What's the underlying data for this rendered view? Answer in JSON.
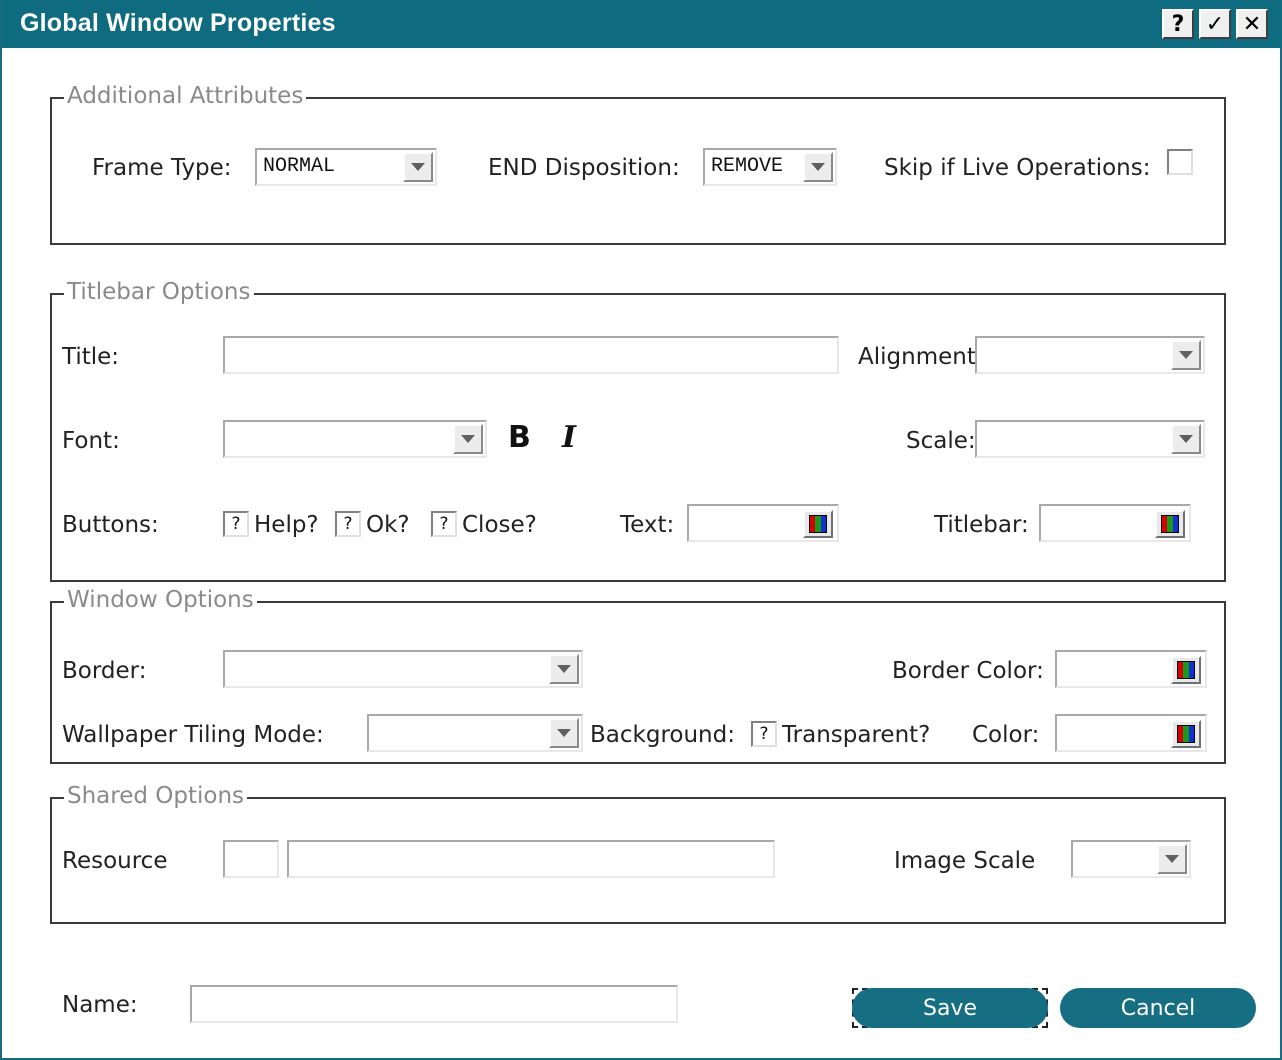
{
  "window": {
    "title": "Global Window Properties",
    "buttons": {
      "help": "?",
      "ok": "✓",
      "close": "✕"
    }
  },
  "additional_attributes": {
    "legend": "Additional Attributes",
    "frame_type_label": "Frame Type:",
    "frame_type_value": "NORMAL",
    "end_disposition_label": "END Disposition:",
    "end_disposition_value": "REMOVE",
    "skip_live_label": "Skip if Live Operations:"
  },
  "titlebar_options": {
    "legend": "Titlebar Options",
    "title_label": "Title:",
    "title_value": "",
    "alignment_label": "Alignment:",
    "alignment_value": "",
    "font_label": "Font:",
    "font_value": "",
    "bold_glyph": "B",
    "italic_glyph": "I",
    "scale_label": "Scale:",
    "scale_value": "",
    "buttons_label": "Buttons:",
    "help_check": "?",
    "help_label": "Help?",
    "ok_check": "?",
    "ok_label": "Ok?",
    "close_check": "?",
    "close_label": "Close?",
    "text_label": "Text:",
    "titlebar_label": "Titlebar:"
  },
  "window_options": {
    "legend": "Window Options",
    "border_label": "Border:",
    "border_value": "",
    "border_color_label": "Border Color:",
    "wallpaper_label": "Wallpaper Tiling Mode:",
    "wallpaper_value": "",
    "background_label": "Background:",
    "transparent_check": "?",
    "transparent_label": "Transparent?",
    "color_label": "Color:"
  },
  "shared_options": {
    "legend": "Shared Options",
    "resource_label": "Resource",
    "resource_short": "",
    "resource_value": "",
    "image_scale_label": "Image Scale",
    "image_scale_value": ""
  },
  "footer": {
    "name_label": "Name:",
    "name_value": "",
    "save_label": "Save",
    "cancel_label": "Cancel"
  },
  "colors": {
    "titlebar_bg": "#0e6b80",
    "button_bg": "#156e82",
    "legend_text": "#8a8a8a",
    "swatch": [
      "#d40000",
      "#1a9a1a",
      "#1030d0"
    ]
  }
}
